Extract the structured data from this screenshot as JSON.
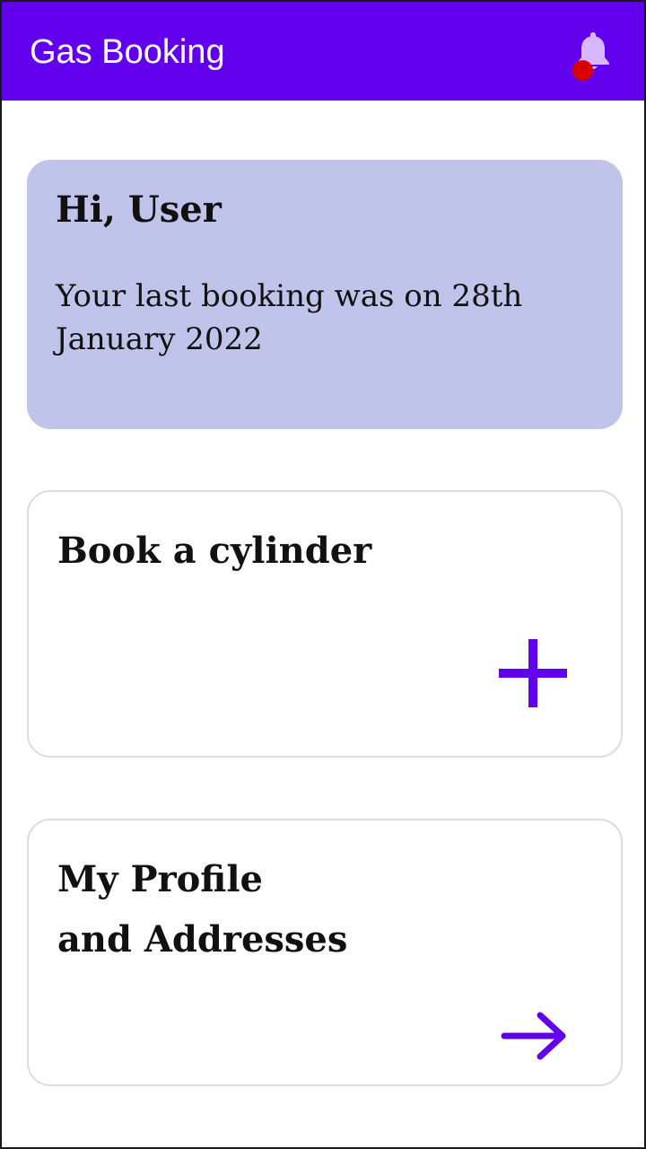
{
  "app_bar": {
    "title": "Gas Booking",
    "background": "#6200EE",
    "notification_icon": "bell-icon",
    "notification_dot_color": "#d90000"
  },
  "greeting": {
    "title": "Hi, User",
    "message": "Your last booking was on 28th January 2022",
    "background": "#C1C4EA"
  },
  "cards": {
    "book": {
      "title_line1": "Book a cylinder",
      "icon": "plus-icon"
    },
    "profile": {
      "title_line1": "My Profile",
      "title_line2": "and Addresses",
      "icon": "arrow-right-icon"
    }
  },
  "accent_color": "#6200EE"
}
